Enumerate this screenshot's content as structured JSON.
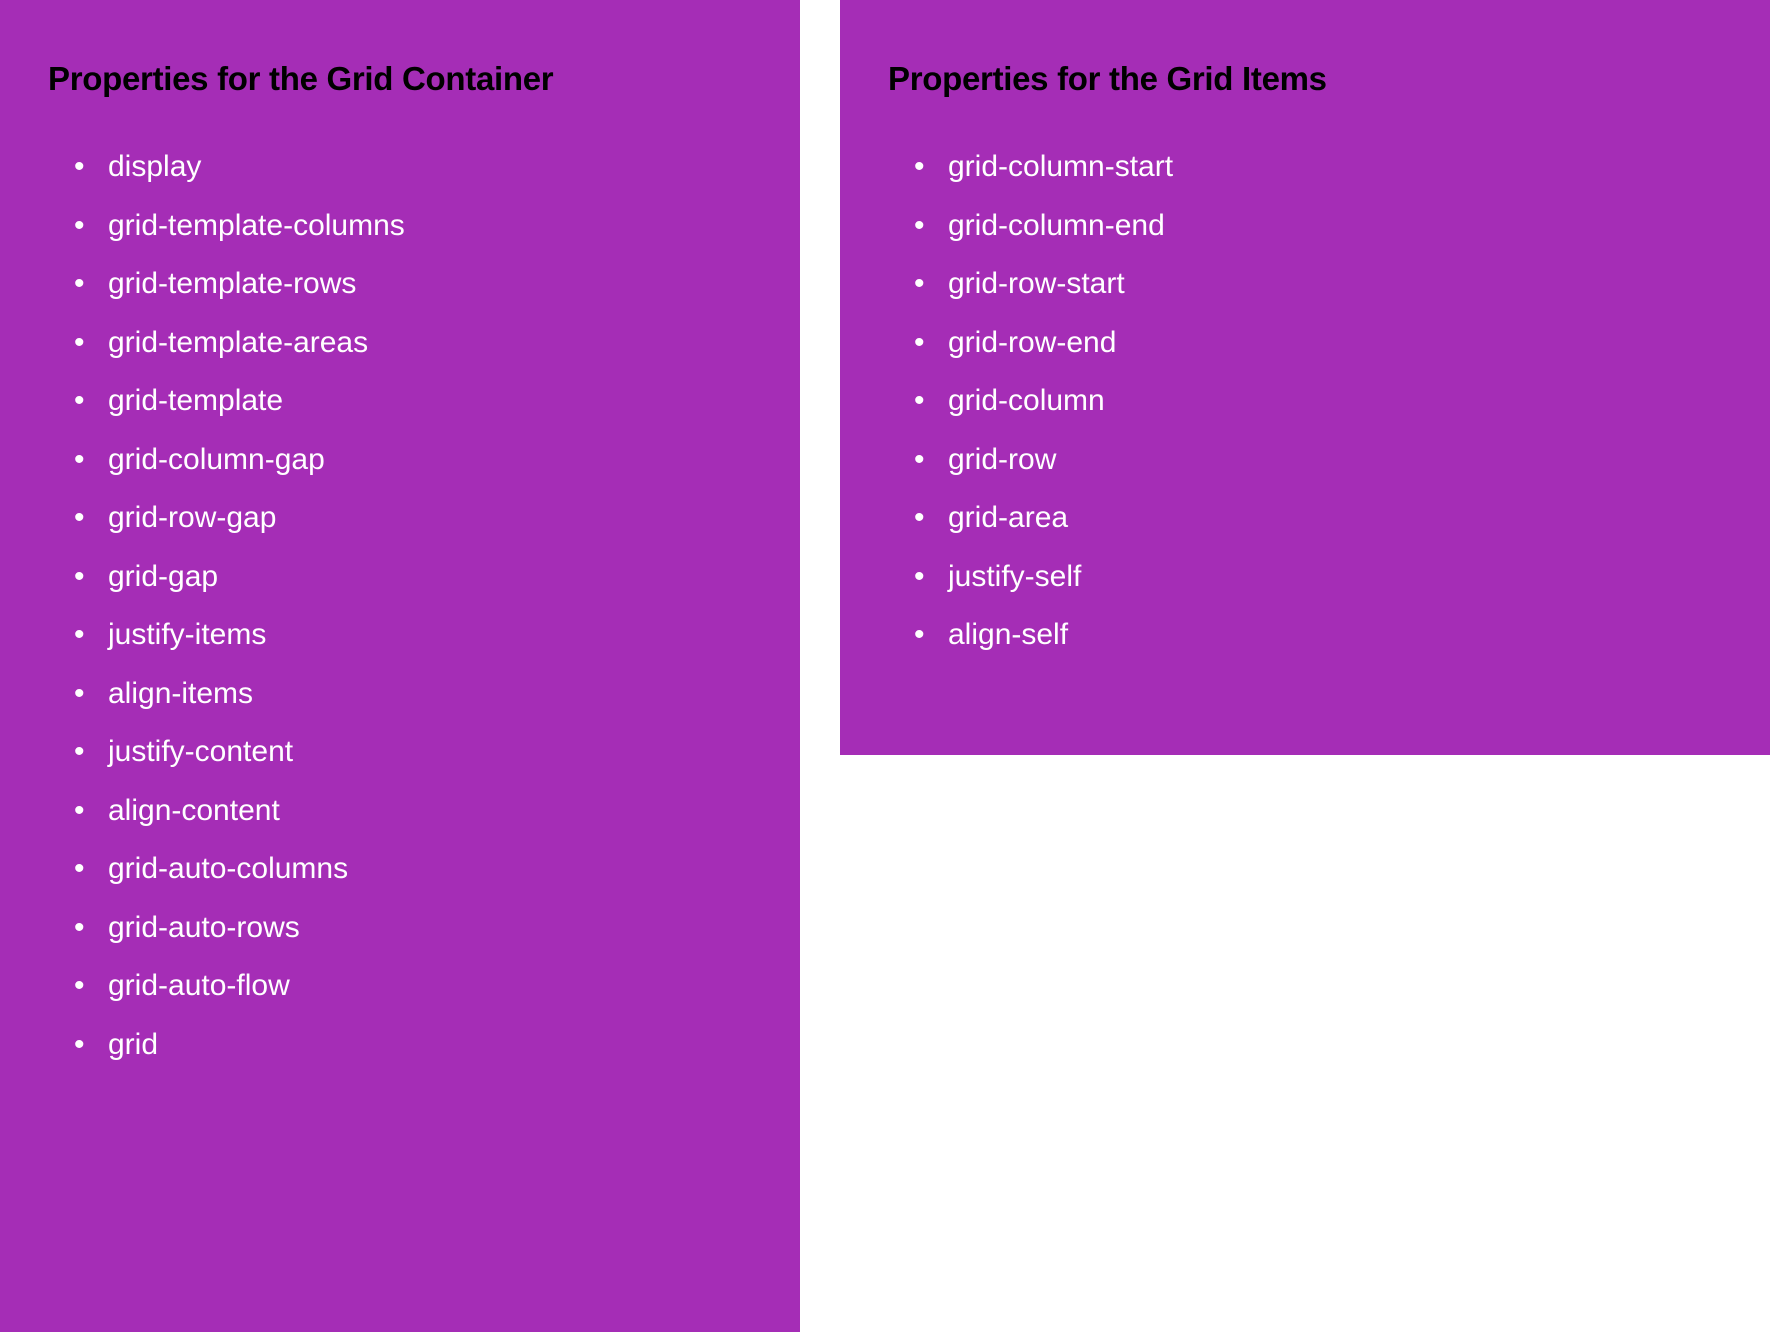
{
  "colors": {
    "panel_bg": "#a52db6",
    "heading": "#000000",
    "list_text": "#ffffff"
  },
  "left": {
    "heading": "Properties for the Grid Container",
    "items": [
      "display",
      "grid-template-columns",
      "grid-template-rows",
      "grid-template-areas",
      "grid-template",
      "grid-column-gap",
      "grid-row-gap",
      "grid-gap",
      "justify-items",
      "align-items",
      "justify-content",
      "align-content",
      "grid-auto-columns",
      "grid-auto-rows",
      "grid-auto-flow",
      "grid"
    ]
  },
  "right": {
    "heading": "Properties for the Grid Items",
    "items": [
      "grid-column-start",
      "grid-column-end",
      "grid-row-start",
      "grid-row-end",
      "grid-column",
      "grid-row",
      "grid-area",
      "justify-self",
      "align-self"
    ]
  }
}
